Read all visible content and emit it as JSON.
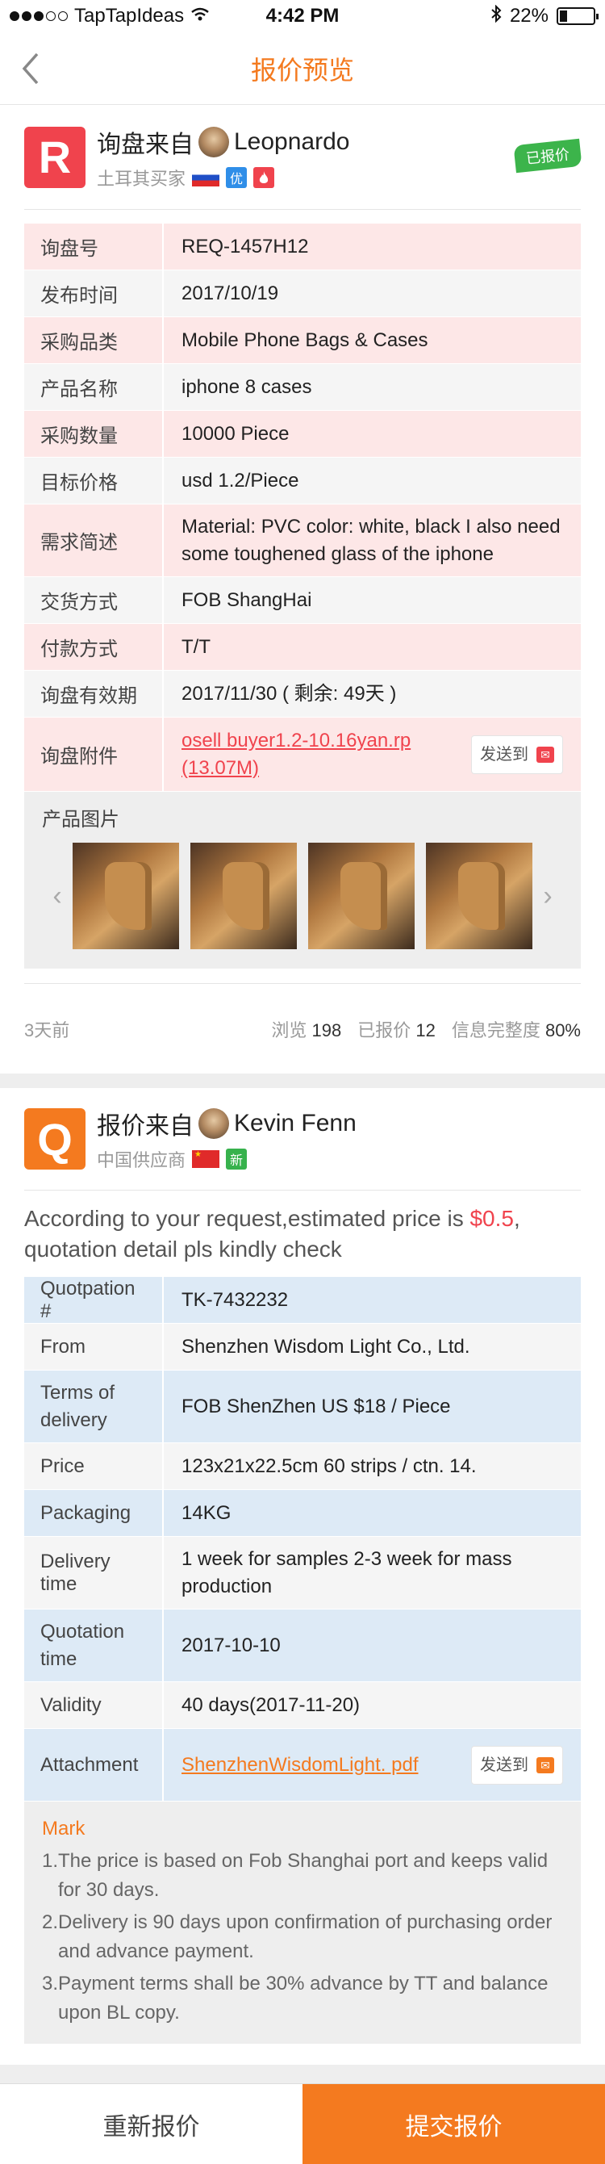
{
  "status_bar": {
    "carrier": "TapTapIdeas",
    "time": "4:42 PM",
    "battery": "22%"
  },
  "nav": {
    "title": "报价预览"
  },
  "inquiry": {
    "from_prefix": "询盘来自",
    "buyer_name": "Leopnardo",
    "buyer_type": "土耳其买家",
    "badge_you": "优",
    "badge_hot": "🔥",
    "quoted_ribbon": "已报价",
    "rows": [
      {
        "label": "询盘号",
        "value": "REQ-1457H12"
      },
      {
        "label": "发布时间",
        "value": "2017/10/19"
      },
      {
        "label": "采购品类",
        "value": "Mobile Phone Bags & Cases"
      },
      {
        "label": "产品名称",
        "value": "iphone 8 cases"
      },
      {
        "label": "采购数量",
        "value": "10000 Piece"
      },
      {
        "label": "目标价格",
        "value": "usd 1.2/Piece"
      },
      {
        "label": "需求简述",
        "value": "Material: PVC color: white, black I also need some toughened glass of the iphone"
      },
      {
        "label": "交货方式",
        "value": "FOB ShangHai"
      },
      {
        "label": "付款方式",
        "value": "T/T"
      },
      {
        "label": "询盘有效期",
        "value": "2017/11/30 ( 剩余: 49天 )"
      }
    ],
    "attachment_label": "询盘附件",
    "attachment_file": "osell buyer1.2-10.16yan.rp (13.07M)",
    "send_label": "发送到",
    "photos_label": "产品图片",
    "posted": "3天前",
    "views_label": "浏览",
    "views": "198",
    "quoted_label": "已报价",
    "quoted": "12",
    "completeness_label": "信息完整度",
    "completeness": "80%"
  },
  "quotation": {
    "from_prefix": "报价来自",
    "supplier_name": "Kevin Fenn",
    "supplier_type": "中国供应商",
    "badge_new": "新",
    "lead_before": "According to your request,estimated price is ",
    "lead_price": "$0.5",
    "lead_after": ", quotation detail pls kindly check",
    "rows": [
      {
        "label": "Quotpation #",
        "value": "TK-7432232"
      },
      {
        "label": "From",
        "value": "Shenzhen Wisdom Light Co., Ltd."
      },
      {
        "label": "Terms of delivery",
        "value": "FOB  ShenZhen US $18 / Piece"
      },
      {
        "label": "Price",
        "value": "123x21x22.5cm 60 strips / ctn. 14."
      },
      {
        "label": "Packaging",
        "value": "14KG"
      },
      {
        "label": "Delivery time",
        "value": "1 week for samples 2-3 week for mass production"
      },
      {
        "label": "Quotation time",
        "value": "2017-10-10"
      },
      {
        "label": "Validity",
        "value": "40 days(2017-11-20)"
      }
    ],
    "attachment_label": "Attachment",
    "attachment_file": "ShenzhenWisdomLight. pdf",
    "send_label": "发送到",
    "mark_title": "Mark",
    "marks": [
      "1.The price is based on Fob Shanghai port and keeps valid for 30 days.",
      "2.Delivery is 90 days upon confirmation of purchasing order and advance payment.",
      "3.Payment terms shall be 30% advance by TT and balance upon BL copy."
    ]
  },
  "actions": {
    "requote": "重新报价",
    "submit": "提交报价"
  },
  "colors": {
    "accent": "#f47a1f",
    "red": "#f0434d",
    "green": "#3cb44b",
    "blue": "#2f8ee8"
  }
}
